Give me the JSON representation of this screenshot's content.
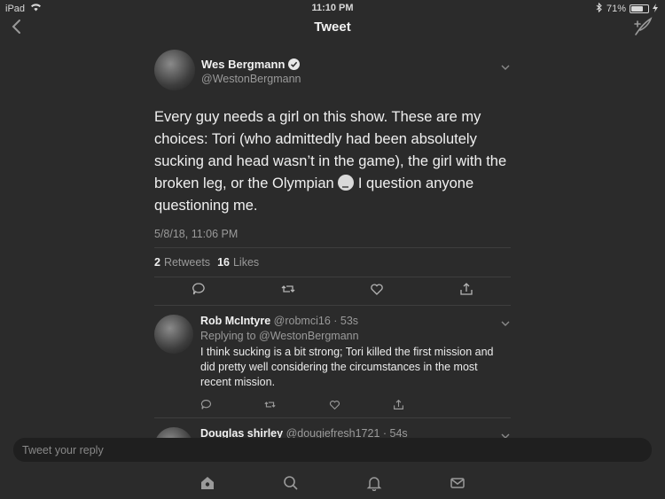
{
  "status": {
    "device": "iPad",
    "time": "11:10 PM",
    "battery": "71%",
    "battery_level": 0.71
  },
  "nav": {
    "title": "Tweet"
  },
  "tweet": {
    "name": "Wes Bergmann",
    "handle": "@WestonBergmann",
    "text_before_emoji": "Every guy needs a girl on this show. These are my choices: Tori (who admittedly had been absolutely sucking and head wasn’t in the game), the girl with the broken leg, or the Olympian",
    "text_after_emoji": " I question anyone questioning me.",
    "timestamp": "5/8/18, 11:06 PM",
    "retweets_count": "2",
    "retweets_label": "Retweets",
    "likes_count": "16",
    "likes_label": "Likes"
  },
  "replies": [
    {
      "name": "Rob McIntyre",
      "meta": "@robmci16 · 53s",
      "replying_label": "Replying to",
      "replying_to": "@WestonBergmann",
      "text": "I think sucking is a bit strong; Tori killed the first mission and did pretty well considering the circumstances in the most recent mission."
    },
    {
      "name": "Douglas shirley",
      "meta": "@dougiefresh1721 · 54s"
    }
  ],
  "composer": {
    "placeholder": "Tweet your reply"
  }
}
